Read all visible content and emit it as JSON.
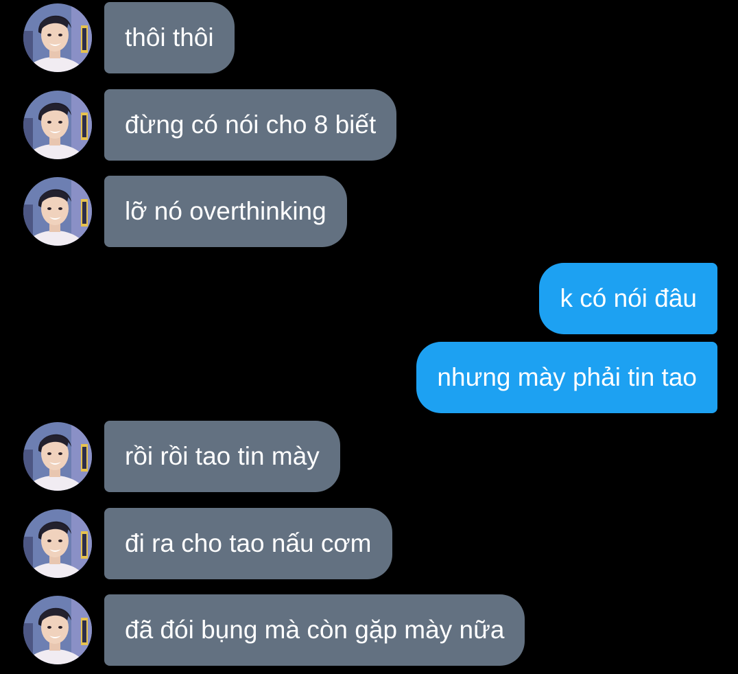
{
  "colors": {
    "background": "#000000",
    "received_bubble": "#637181",
    "sent_bubble": "#1da1f2",
    "text": "#ffffff"
  },
  "messages": [
    {
      "direction": "received",
      "text": "thôi thôi"
    },
    {
      "direction": "received",
      "text": "đừng có nói cho 8 biết"
    },
    {
      "direction": "received",
      "text": "lỡ nó overthinking"
    },
    {
      "direction": "sent",
      "text": "k có nói đâu"
    },
    {
      "direction": "sent",
      "text": "nhưng mày phải tin tao"
    },
    {
      "direction": "received",
      "text": "rồi rồi tao tin mày"
    },
    {
      "direction": "received",
      "text": "đi ra cho tao nấu cơm"
    },
    {
      "direction": "received",
      "text": "đã đói bụng mà còn gặp mày nữa"
    }
  ]
}
